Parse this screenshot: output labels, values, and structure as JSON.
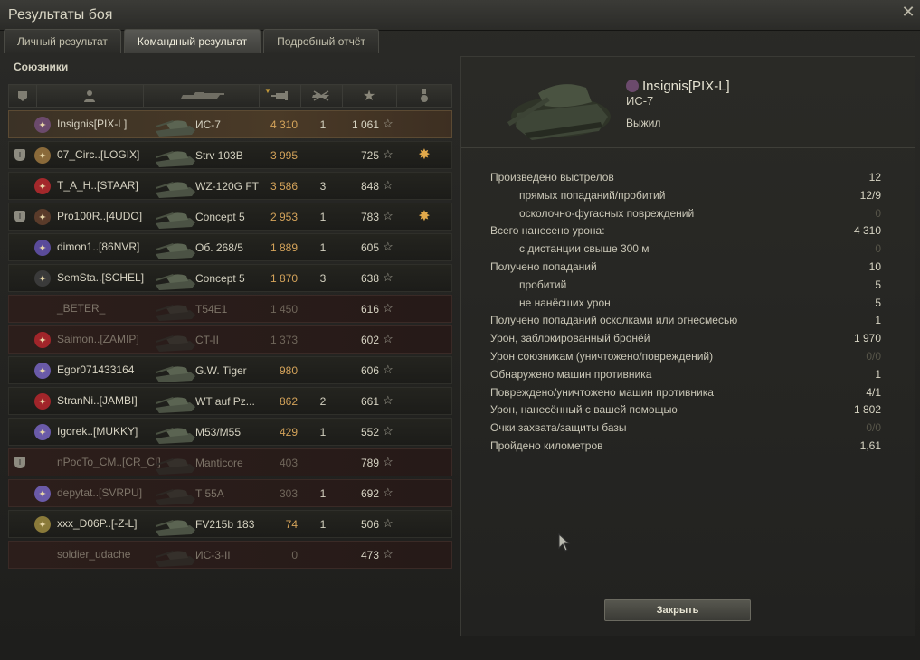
{
  "window": {
    "title": "Результаты боя"
  },
  "tabs": [
    {
      "label": "Личный результат",
      "active": false
    },
    {
      "label": "Командный результат",
      "active": true
    },
    {
      "label": "Подробный отчёт",
      "active": false
    }
  ],
  "allies": {
    "label": "Союзники",
    "columns": [
      "squad",
      "player",
      "vehicle",
      "damage",
      "frags",
      "xp",
      "medal"
    ],
    "rows": [
      {
        "squad": "",
        "player": "Insignis[PIX-L]",
        "vehicle": "ИС-7",
        "damage": "4 310",
        "frags": "1",
        "xp": "1 061",
        "state": "highlight",
        "rank_color": "#6b4a6c",
        "medal": false
      },
      {
        "squad": "I",
        "player": "07_Circ..[LOGIX]",
        "vehicle": "Strv 103B",
        "damage": "3 995",
        "frags": "",
        "xp": "725",
        "state": "normal",
        "rank_color": "#8a6a3a",
        "medal": true
      },
      {
        "squad": "",
        "player": "T_A_H..[STAAR]",
        "vehicle": "WZ-120G FT",
        "damage": "3 586",
        "frags": "3",
        "xp": "848",
        "state": "normal",
        "rank_color": "#a3282b",
        "medal": false
      },
      {
        "squad": "I",
        "player": "Pro100R..[4UDO]",
        "vehicle": "Concept 5",
        "damage": "2 953",
        "frags": "1",
        "xp": "783",
        "state": "normal",
        "rank_color": "#5a3b2a",
        "medal": true
      },
      {
        "squad": "",
        "player": "dimon1..[86NVR]",
        "vehicle": "Об. 268/5",
        "damage": "1 889",
        "frags": "1",
        "xp": "605",
        "state": "normal",
        "rank_color": "#5a4b9a",
        "medal": false
      },
      {
        "squad": "",
        "player": "SemSta..[SCHEL]",
        "vehicle": "Concept 5",
        "damage": "1 870",
        "frags": "3",
        "xp": "638",
        "state": "normal",
        "rank_color": "#3a3a3a",
        "medal": false
      },
      {
        "squad": "",
        "player": "_BETER_",
        "vehicle": "T54E1",
        "damage": "1 450",
        "frags": "",
        "xp": "616",
        "state": "dead",
        "rank_color": "",
        "medal": false
      },
      {
        "squad": "",
        "player": "Saimon..[ZAMIP]",
        "vehicle": "CT-II",
        "damage": "1 373",
        "frags": "",
        "xp": "602",
        "state": "dead",
        "rank_color": "#a1252a",
        "medal": false
      },
      {
        "squad": "",
        "player": "Egor071433164",
        "vehicle": "G.W. Tiger",
        "damage": "980",
        "frags": "",
        "xp": "606",
        "state": "normal",
        "rank_color": "#6a5aa8",
        "medal": false
      },
      {
        "squad": "",
        "player": "StranNi..[JAMBI]",
        "vehicle": "WT auf Pz...",
        "damage": "862",
        "frags": "2",
        "xp": "661",
        "state": "normal",
        "rank_color": "#a1252a",
        "medal": false
      },
      {
        "squad": "",
        "player": "Igorek..[MUKKY]",
        "vehicle": "M53/M55",
        "damage": "429",
        "frags": "1",
        "xp": "552",
        "state": "normal",
        "rank_color": "#6a5aa8",
        "medal": false
      },
      {
        "squad": "I",
        "player": "nPocTo_CM..[CR_CI]",
        "vehicle": "Manticore",
        "damage": "403",
        "frags": "",
        "xp": "789",
        "state": "dead",
        "rank_color": "",
        "medal": false
      },
      {
        "squad": "",
        "player": "depytat..[SVRPU]",
        "vehicle": "T 55A",
        "damage": "303",
        "frags": "1",
        "xp": "692",
        "state": "dead",
        "rank_color": "#6a5aa8",
        "medal": false
      },
      {
        "squad": "",
        "player": "xxx_D06P..[-Z-L]",
        "vehicle": "FV215b 183",
        "damage": "74",
        "frags": "1",
        "xp": "506",
        "state": "normal",
        "rank_color": "#8a7a3a",
        "medal": false
      },
      {
        "squad": "",
        "player": "soldier_udache",
        "vehicle": "ИС-3-II",
        "damage": "0",
        "frags": "",
        "xp": "473",
        "state": "dead",
        "rank_color": "",
        "medal": false
      }
    ]
  },
  "detail": {
    "player": "Insignis[PIX-L]",
    "tank": "ИС-7",
    "status": "Выжил",
    "stats": [
      {
        "label": "Произведено выстрелов",
        "value": "12",
        "sub": false,
        "zero": false
      },
      {
        "label": "прямых попаданий/пробитий",
        "value": "12/9",
        "sub": true,
        "zero": false
      },
      {
        "label": "осколочно-фугасных повреждений",
        "value": "0",
        "sub": true,
        "zero": true
      },
      {
        "label": "Всего нанесено урона:",
        "value": "4 310",
        "sub": false,
        "zero": false
      },
      {
        "label": "с дистанции свыше 300 м",
        "value": "0",
        "sub": true,
        "zero": true
      },
      {
        "label": "Получено попаданий",
        "value": "10",
        "sub": false,
        "zero": false
      },
      {
        "label": "пробитий",
        "value": "5",
        "sub": true,
        "zero": false
      },
      {
        "label": "не нанёсших урон",
        "value": "5",
        "sub": true,
        "zero": false
      },
      {
        "label": "Получено попаданий осколками или огнесмесью",
        "value": "1",
        "sub": false,
        "zero": false
      },
      {
        "label": "Урон, заблокированный бронёй",
        "value": "1 970",
        "sub": false,
        "zero": false
      },
      {
        "label": "Урон союзникам (уничтожено/повреждений)",
        "value": "0/0",
        "sub": false,
        "zero": true
      },
      {
        "label": "Обнаружено машин противника",
        "value": "1",
        "sub": false,
        "zero": false
      },
      {
        "label": "Повреждено/уничтожено машин противника",
        "value": "4/1",
        "sub": false,
        "zero": false
      },
      {
        "label": "Урон, нанесённый с вашей помощью",
        "value": "1 802",
        "sub": false,
        "zero": false
      },
      {
        "label": "Очки захвата/защиты базы",
        "value": "0/0",
        "sub": false,
        "zero": true
      },
      {
        "label": "Пройдено километров",
        "value": "1,61",
        "sub": false,
        "zero": false
      }
    ],
    "close_label": "Закрыть"
  },
  "icons": {
    "close": "close-icon",
    "star": "star-icon",
    "medal": "medal-icon"
  }
}
